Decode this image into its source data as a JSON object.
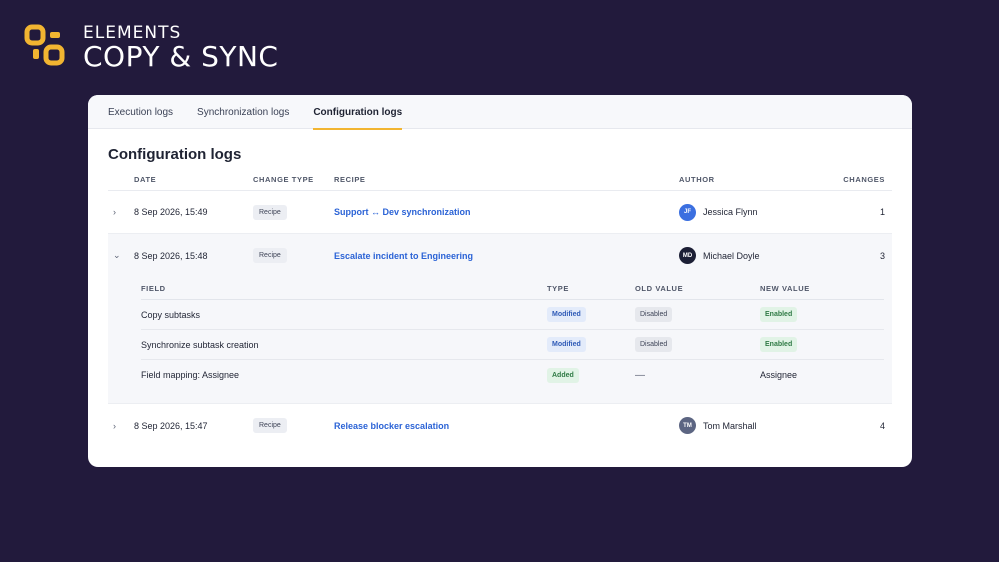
{
  "brand": {
    "line1": "ELEMENTS",
    "line2": "COPY & SYNC",
    "accent": "#f2b531",
    "logo_icon": "copy-sync-logo-icon"
  },
  "tabs": [
    {
      "label": "Execution logs",
      "active": false
    },
    {
      "label": "Synchronization logs",
      "active": false
    },
    {
      "label": "Configuration logs",
      "active": true
    }
  ],
  "page_title": "Configuration logs",
  "columns": {
    "date": "DATE",
    "change_type": "CHANGE TYPE",
    "recipe": "RECIPE",
    "author": "AUTHOR",
    "changes": "CHANGES"
  },
  "rows": [
    {
      "chevron": "›",
      "date": "8 Sep 2026, 15:49",
      "change_type": "Recipe",
      "recipe": "Support ↔ Dev synchronization",
      "author_initials": "JF",
      "author": "Jessica Flynn",
      "avatar_color": "#3b6fe0",
      "changes": "1"
    },
    {
      "chevron": "⌄",
      "date": "8 Sep 2026, 15:48",
      "change_type": "Recipe",
      "recipe": "Escalate incident to Engineering",
      "author_initials": "MD",
      "author": "Michael Doyle",
      "avatar_color": "#1c1f35",
      "changes": "3"
    },
    {
      "chevron": "›",
      "date": "8 Sep 2026, 15:47",
      "change_type": "Recipe",
      "recipe": "Release blocker escalation",
      "author_initials": "TM",
      "author": "Tom Marshall",
      "avatar_color": "#5c6582",
      "changes": "4"
    }
  ],
  "details": {
    "columns": {
      "field": "FIELD",
      "type": "TYPE",
      "old_value": "OLD VALUE",
      "new_value": "NEW VALUE"
    },
    "rows": [
      {
        "field": "Copy subtasks",
        "type": "Modified",
        "old_value": "Disabled",
        "new_value": "Enabled"
      },
      {
        "field": "Synchronize subtask creation",
        "type": "Modified",
        "old_value": "Disabled",
        "new_value": "Enabled"
      },
      {
        "field": "Field mapping: Assignee",
        "type": "Added",
        "old_value": "—",
        "new_value": "Assignee"
      }
    ]
  }
}
